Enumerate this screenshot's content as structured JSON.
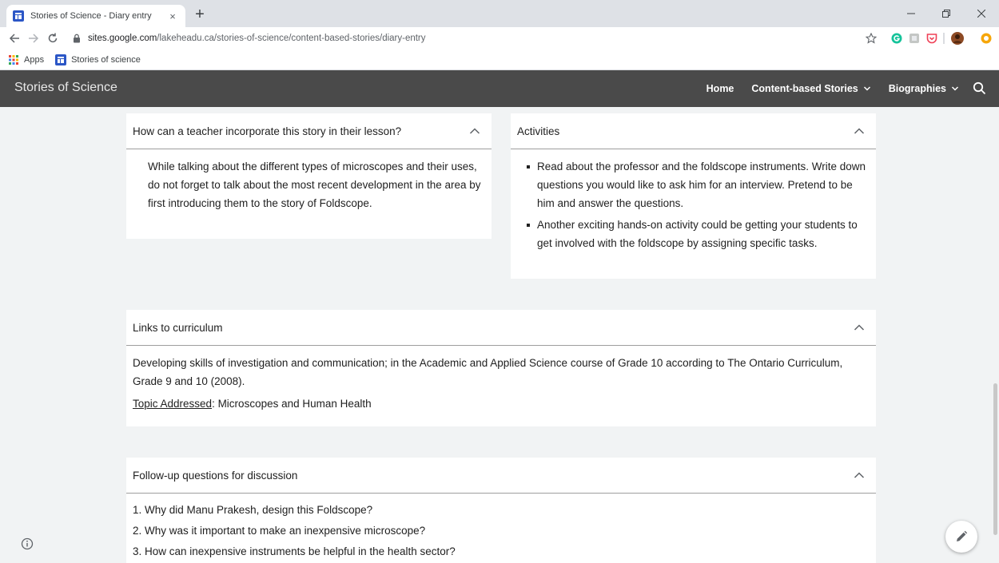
{
  "browser": {
    "tab_title": "Stories of Science - Diary entry",
    "tab_close": "×",
    "new_tab": "+",
    "url_domain": "sites.google.com",
    "url_path": "/lakeheadu.ca/stories-of-science/content-based-stories/diary-entry",
    "bookmarks": [
      {
        "label": "Apps",
        "icon": "apps-grid-icon"
      },
      {
        "label": "Stories of science",
        "icon": "google-sites-icon"
      }
    ]
  },
  "site": {
    "title": "Stories of Science",
    "nav": {
      "home": "Home",
      "content_based": "Content-based Stories",
      "biographies": "Biographies"
    }
  },
  "sections": {
    "teacher": {
      "title": "How can a teacher incorporate this story in their lesson?",
      "body": "While talking about the different types of microscopes and their uses, do not forget to talk about the most recent development in the area by first introducing them to the story of Foldscope."
    },
    "activities": {
      "title": "Activities",
      "items": [
        "Read about the professor and the foldscope instruments. Write down questions you would like to ask him for an interview. Pretend to be him and answer the questions.",
        "Another exciting hands-on activity could be getting your students to get involved with the foldscope by assigning specific tasks."
      ]
    },
    "curriculum": {
      "title": "Links to curriculum",
      "body": "Developing skills of investigation and communication; in the Academic and Applied Science course of Grade 10 according to The Ontario Curriculum, Grade 9 and 10 (2008).",
      "topic_label": "Topic Addressed",
      "topic_value": ": Microscopes and Human Health"
    },
    "followup": {
      "title": "Follow-up questions for discussion",
      "questions": [
        "1. Why did Manu Prakesh, design this Foldscope?",
        "2. Why was it important to make an inexpensive microscope?",
        "3. How can inexpensive instruments be helpful in the health sector?"
      ]
    }
  },
  "colors": {
    "header_bg": "#4a4a4a",
    "page_bg": "#f1f3f4",
    "card_bg": "#ffffff"
  }
}
